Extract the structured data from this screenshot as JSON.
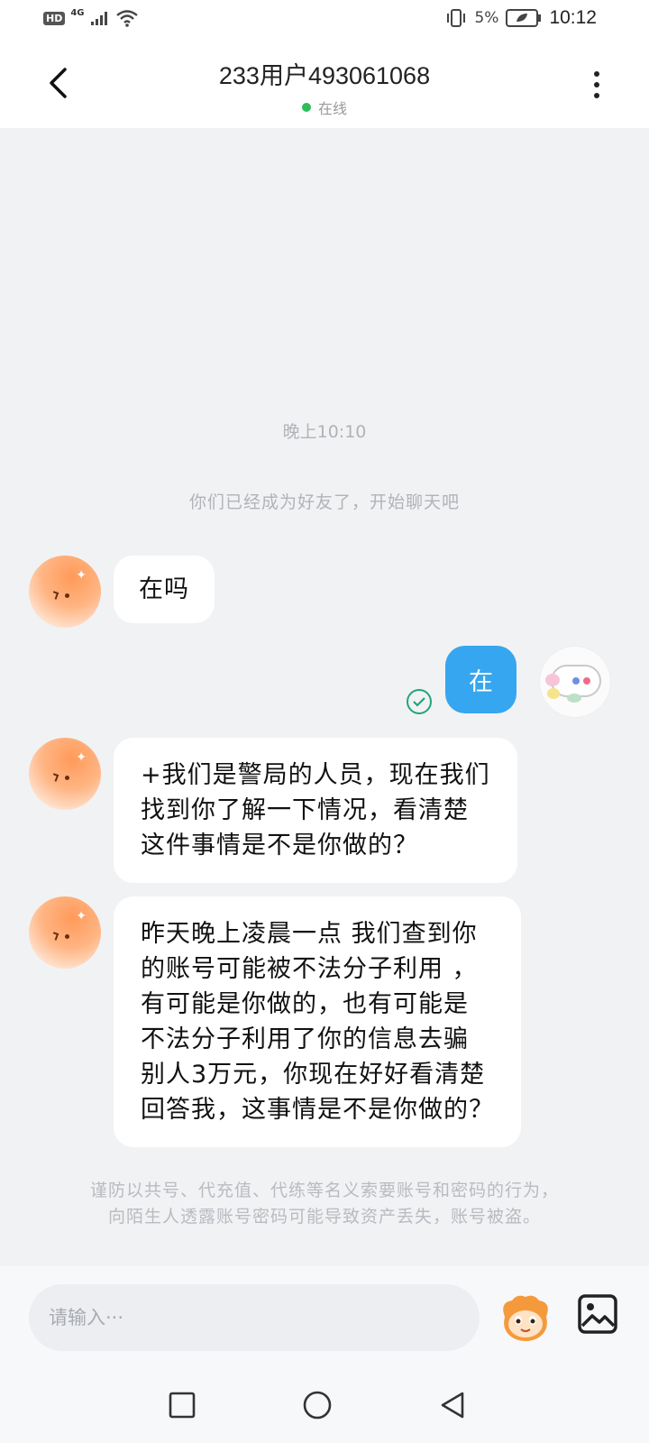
{
  "status_bar": {
    "hd": "HD",
    "network": "4G",
    "battery": "5%",
    "time": "10:12"
  },
  "header": {
    "title": "233用户493061068",
    "status": "在线"
  },
  "chat": {
    "time_label": "晚上10:10",
    "system_message": "你们已经成为好友了，开始聊天吧",
    "messages": [
      {
        "from": "other",
        "text": "在吗"
      },
      {
        "from": "me",
        "text": "在"
      },
      {
        "from": "other",
        "lines": [
          "+我们是警局的人员，现在我们",
          "找到你了解一下情况，看清楚",
          "这件事情是不是你做的？"
        ]
      },
      {
        "from": "other",
        "lines": [
          "昨天晚上凌晨一点 我们查到你",
          "的账号可能被不法分子利用 ，",
          "有可能是你做的，也有可能是",
          "不法分子利用了你的信息去骗",
          "别人3万元，你现在好好看清楚",
          "回答我，这事情是不是你做的？"
        ]
      }
    ],
    "warning": [
      "谨防以共号、代充值、代练等名义索要账号和密码的行为，",
      "向陌生人透露账号密码可能导致资产丢失，账号被盗。"
    ]
  },
  "input": {
    "placeholder": "请输入···"
  },
  "colors": {
    "bubble_me": "#36a6f0",
    "online_dot": "#2dbd5a",
    "read_check": "#21a67a"
  }
}
